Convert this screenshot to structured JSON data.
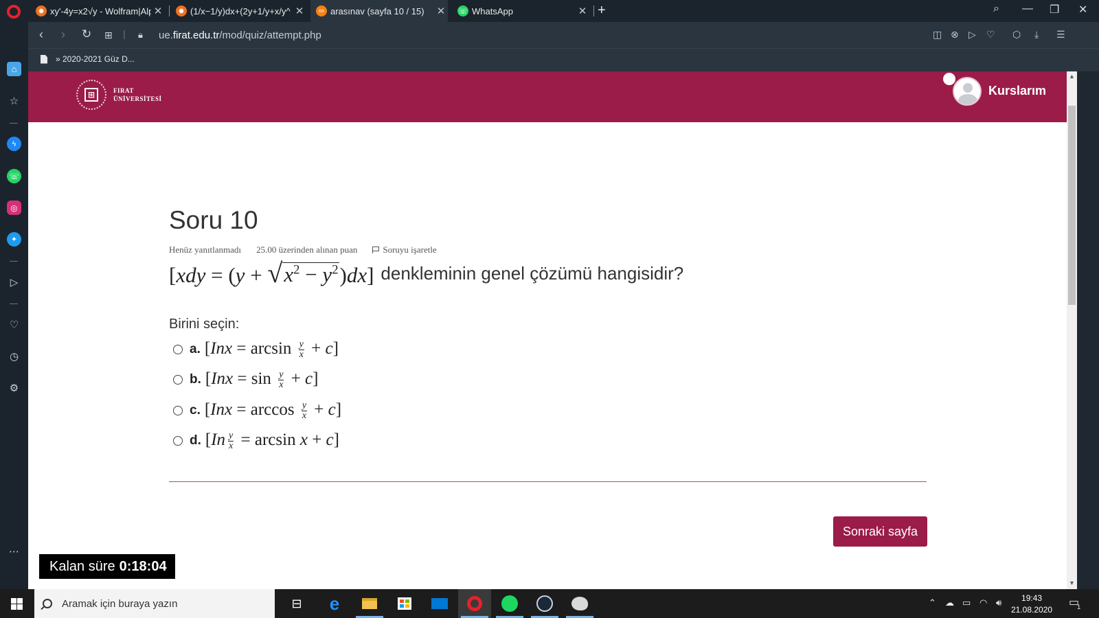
{
  "browser": {
    "tabs": [
      {
        "title": "xy'-4y=x2√y - Wolfram|Alp",
        "favicon": "wolfram-icon",
        "color": "#f0701e"
      },
      {
        "title": "(1/x−1/y)dx+(2y+1/y+x/y^",
        "favicon": "wolfram-icon",
        "color": "#f0701e"
      },
      {
        "title": "arasınav (sayfa 10 / 15)",
        "favicon": "moodle-icon",
        "color": "#f98012"
      },
      {
        "title": "WhatsApp",
        "favicon": "whatsapp-icon",
        "color": "#25d366"
      }
    ],
    "url_prefix": "ue.",
    "url_domain": "firat.edu.tr",
    "url_path": "/mod/quiz/attempt.php",
    "bookmark": "» 2020-2021 Güz D..."
  },
  "header": {
    "logo_line1": "FIRAT",
    "logo_line2": "ÜNİVERSİTESİ",
    "user_menu": "Kurslarım"
  },
  "question": {
    "title": "Soru 10",
    "status": "Henüz yanıtlanmadı",
    "marks": "25.00 üzerinden alınan puan",
    "flag": "Soruyu işaretle",
    "text": "denkleminin genel çözümü hangisidir?",
    "prompt": "Birini seçin:",
    "options": [
      {
        "letter": "a.",
        "fn": "arcsin"
      },
      {
        "letter": "b.",
        "fn": "sin"
      },
      {
        "letter": "c.",
        "fn": "arccos"
      },
      {
        "letter": "d.",
        "fn": "arcsin"
      }
    ]
  },
  "next_button": "Sonraki sayfa",
  "timer": {
    "label": "Kalan süre",
    "value": "0:18:04"
  },
  "taskbar": {
    "search_placeholder": "Aramak için buraya yazın",
    "time": "19:43",
    "date": "21.08.2020",
    "notifications": "1"
  },
  "colors": {
    "brand": "#9b1c48",
    "browser_bg": "#2a3540"
  }
}
